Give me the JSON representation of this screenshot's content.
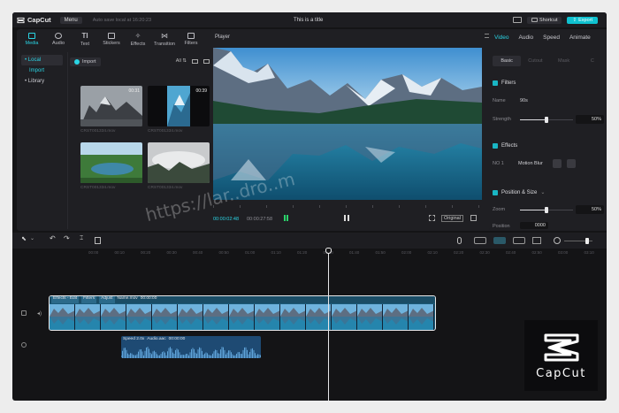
{
  "app": {
    "name": "CapCut",
    "menu_label": "Menu",
    "autosave": "Auto save local at 16:20:23",
    "title": "This is a title",
    "shortcut_label": "Shortcut",
    "export_label": "Export"
  },
  "media_panel": {
    "tabs": [
      {
        "label": "Media",
        "icon": "media-icon"
      },
      {
        "label": "Audio",
        "icon": "audio-icon"
      },
      {
        "label": "Text",
        "icon": "text-icon"
      },
      {
        "label": "Stickers",
        "icon": "stickers-icon"
      },
      {
        "label": "Effects",
        "icon": "effects-icon"
      },
      {
        "label": "Transition",
        "icon": "transition-icon"
      },
      {
        "label": "Filters",
        "icon": "filters-icon"
      }
    ],
    "sidebar": {
      "local": "• Local",
      "import": "Import",
      "library": "• Library"
    },
    "import_button": "Import",
    "filter_all": "All",
    "files": [
      {
        "name": "CRST001334.mov",
        "duration": "00:31"
      },
      {
        "name": "CRST001334.mov",
        "duration": "00:39"
      },
      {
        "name": "CRST001334.mov",
        "duration": ""
      },
      {
        "name": "CRST001334.mov",
        "duration": ""
      }
    ]
  },
  "player": {
    "label": "Player",
    "current_time": "00:00:02:48",
    "total_time": "00:00:27:58",
    "original_label": "Original"
  },
  "inspector": {
    "tabs": [
      "Video",
      "Audio",
      "Speed",
      "Animate"
    ],
    "sub_tabs": [
      "Basic",
      "Cutout",
      "Mask",
      "C"
    ],
    "filters": {
      "title": "Filters",
      "name_label": "Name",
      "name_value": "90s",
      "strength_label": "Strength",
      "strength_value": "50%",
      "strength_fraction": 0.5
    },
    "effects": {
      "title": "Effects",
      "item_label": "NO 1",
      "item_value": "Motion Blur"
    },
    "position_size": {
      "title": "Position & Size",
      "zoom_label": "Zoom",
      "zoom_value": "50%",
      "zoom_fraction": 0.5,
      "position_label": "Position",
      "position_value": "0000"
    }
  },
  "timeline": {
    "ticks": [
      "00:00",
      "00:10",
      "00:20",
      "00:30",
      "00:40",
      "00:50",
      "01:00",
      "01:10",
      "01:20",
      "01:30",
      "01:40",
      "01:50",
      "02:00",
      "02:10",
      "02:20",
      "02:30",
      "02:40",
      "02:50",
      "03:00",
      "03:10",
      "03:20"
    ],
    "video_clip": {
      "tags": [
        "Effects - Edit",
        "Filters",
        "Adjust",
        "Name.mov",
        "00:00:00"
      ]
    },
    "audio_clip": {
      "tags": [
        "Speed 2.0x",
        "Audio.aac",
        "00:00:00"
      ]
    }
  },
  "watermark": "https://lar..dro..m",
  "logo_text": "CapCut",
  "colors": {
    "accent": "#2ad4e4",
    "export": "#0fc1cf",
    "background": "#141416"
  }
}
